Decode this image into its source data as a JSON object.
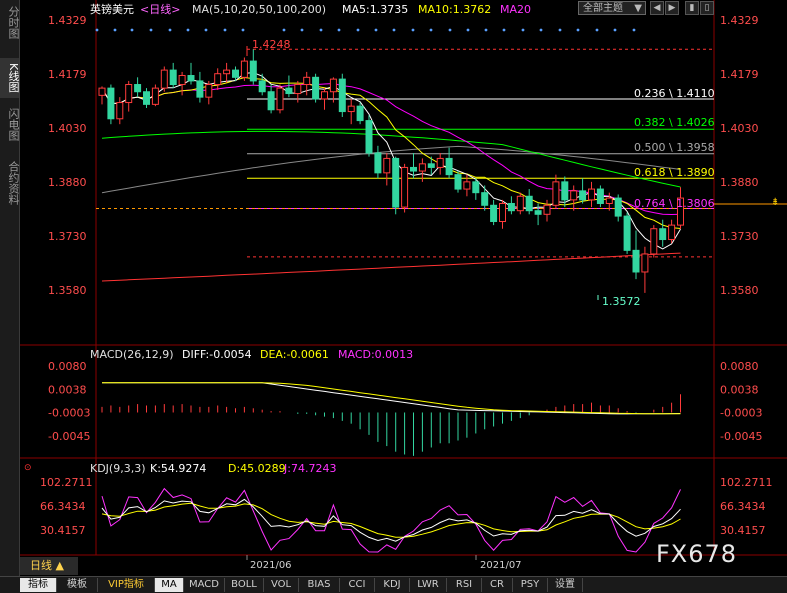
{
  "left_tabs": [
    {
      "label": "分时图",
      "active": false
    },
    {
      "label": "K线图",
      "active": true
    },
    {
      "label": "闪电图",
      "active": false
    },
    {
      "label": "合约资料",
      "active": false
    }
  ],
  "header": {
    "symbol": "英镑美元",
    "period_tag": "<日线>",
    "ma_label": "MA(5,10,20,50,100,200)",
    "ma5": "MA5:1.3735",
    "ma10": "MA10:1.3762",
    "ma20": "MA20",
    "topic_select": "全部主题",
    "colors": {
      "ma5": "#ffffff",
      "ma10": "#ffff00",
      "ma20": "#ff00ff",
      "ma50": "#00ff00",
      "ma100": "#888888",
      "ma200": "#ff3333"
    }
  },
  "price_axis": {
    "labels": [
      "1.4329",
      "1.4179",
      "1.4030",
      "1.3880",
      "1.3730",
      "1.3580"
    ]
  },
  "annotations": {
    "high_label": "1.4248",
    "low_label": "1.3572",
    "fib": [
      {
        "label": "0.236 \\ 1.4110",
        "color": "#ffffff"
      },
      {
        "label": "0.382 \\ 1.4026",
        "color": "#00ff00"
      },
      {
        "label": "0.500 \\ 1.3958",
        "color": "#aaaaaa"
      },
      {
        "label": "0.618 \\ 1.3890",
        "color": "#ffff00"
      },
      {
        "label": "0.764 \\ 1.3806",
        "color": "#ff33ff"
      }
    ]
  },
  "macd": {
    "label": "MACD(26,12,9)",
    "diff": "DIFF:-0.0054",
    "dea": "DEA:-0.0061",
    "macd": "MACD:0.0013",
    "axis": [
      "0.0080",
      "0.0038",
      "-0.0003",
      "-0.0045"
    ]
  },
  "kdj": {
    "label": "KDJ(9,3,3)",
    "k": "K:54.9274",
    "d": "D:45.0289",
    "j": "J:74.7243",
    "axis": [
      "102.2711",
      "66.3434",
      "30.4157"
    ]
  },
  "time_axis": [
    "2021/06",
    "2021/07"
  ],
  "period_button": "日线 ▲",
  "watermark": "FX678",
  "bottom_tabs": [
    "指标",
    "模板",
    "VIP指标",
    "MA",
    "MACD",
    "BOLL",
    "VOL",
    "BIAS",
    "CCI",
    "KDJ",
    "LWR",
    "RSI",
    "CR",
    "PSY",
    "设置"
  ],
  "chart_data": {
    "type": "candlestick",
    "candles": [
      [
        1.412,
        1.4145,
        1.4095,
        1.414
      ],
      [
        1.414,
        1.415,
        1.404,
        1.4055
      ],
      [
        1.4055,
        1.4115,
        1.404,
        1.41
      ],
      [
        1.41,
        1.416,
        1.4075,
        1.415
      ],
      [
        1.415,
        1.417,
        1.4115,
        1.413
      ],
      [
        1.413,
        1.414,
        1.4085,
        1.4095
      ],
      [
        1.4095,
        1.415,
        1.409,
        1.414
      ],
      [
        1.414,
        1.42,
        1.413,
        1.419
      ],
      [
        1.419,
        1.421,
        1.414,
        1.415
      ],
      [
        1.415,
        1.4185,
        1.412,
        1.4175
      ],
      [
        1.4175,
        1.421,
        1.415,
        1.416
      ],
      [
        1.416,
        1.4185,
        1.41,
        1.4115
      ],
      [
        1.4115,
        1.416,
        1.4095,
        1.415
      ],
      [
        1.415,
        1.4195,
        1.4135,
        1.418
      ],
      [
        1.418,
        1.421,
        1.4155,
        1.419
      ],
      [
        1.419,
        1.42,
        1.416,
        1.417
      ],
      [
        1.417,
        1.4225,
        1.416,
        1.4215
      ],
      [
        1.4215,
        1.4248,
        1.415,
        1.416
      ],
      [
        1.416,
        1.418,
        1.412,
        1.413
      ],
      [
        1.413,
        1.415,
        1.407,
        1.408
      ],
      [
        1.408,
        1.415,
        1.407,
        1.414
      ],
      [
        1.414,
        1.4175,
        1.4115,
        1.4125
      ],
      [
        1.4125,
        1.416,
        1.41,
        1.415
      ],
      [
        1.415,
        1.4185,
        1.412,
        1.417
      ],
      [
        1.417,
        1.418,
        1.41,
        1.411
      ],
      [
        1.411,
        1.414,
        1.408,
        1.413
      ],
      [
        1.413,
        1.417,
        1.41,
        1.4165
      ],
      [
        1.4165,
        1.418,
        1.406,
        1.4075
      ],
      [
        1.4075,
        1.411,
        1.404,
        1.409
      ],
      [
        1.409,
        1.41,
        1.404,
        1.405
      ],
      [
        1.405,
        1.4065,
        1.395,
        1.396
      ],
      [
        1.396,
        1.398,
        1.389,
        1.3905
      ],
      [
        1.3905,
        1.396,
        1.387,
        1.3945
      ],
      [
        1.3945,
        1.395,
        1.379,
        1.381
      ],
      [
        1.381,
        1.393,
        1.3795,
        1.392
      ],
      [
        1.392,
        1.396,
        1.389,
        1.391
      ],
      [
        1.391,
        1.3945,
        1.388,
        1.393
      ],
      [
        1.393,
        1.395,
        1.39,
        1.392
      ],
      [
        1.392,
        1.396,
        1.39,
        1.3945
      ],
      [
        1.3945,
        1.3975,
        1.389,
        1.39
      ],
      [
        1.39,
        1.391,
        1.385,
        1.386
      ],
      [
        1.386,
        1.39,
        1.384,
        1.388
      ],
      [
        1.388,
        1.389,
        1.383,
        1.385
      ],
      [
        1.385,
        1.387,
        1.38,
        1.3815
      ],
      [
        1.3815,
        1.383,
        1.376,
        1.377
      ],
      [
        1.377,
        1.383,
        1.375,
        1.382
      ],
      [
        1.382,
        1.384,
        1.379,
        1.38
      ],
      [
        1.38,
        1.385,
        1.379,
        1.384
      ],
      [
        1.384,
        1.386,
        1.379,
        1.38
      ],
      [
        1.38,
        1.382,
        1.376,
        1.379
      ],
      [
        1.379,
        1.383,
        1.377,
        1.3815
      ],
      [
        1.3815,
        1.39,
        1.3805,
        1.388
      ],
      [
        1.388,
        1.3895,
        1.381,
        1.383
      ],
      [
        1.383,
        1.387,
        1.38,
        1.3855
      ],
      [
        1.3855,
        1.389,
        1.382,
        1.383
      ],
      [
        1.383,
        1.388,
        1.381,
        1.386
      ],
      [
        1.386,
        1.387,
        1.381,
        1.382
      ],
      [
        1.382,
        1.385,
        1.38,
        1.3835
      ],
      [
        1.3835,
        1.3845,
        1.377,
        1.3785
      ],
      [
        1.3785,
        1.3795,
        1.368,
        1.369
      ],
      [
        1.369,
        1.3745,
        1.361,
        1.363
      ],
      [
        1.363,
        1.37,
        1.3572,
        1.368
      ],
      [
        1.368,
        1.376,
        1.367,
        1.375
      ],
      [
        1.375,
        1.3775,
        1.37,
        1.372
      ],
      [
        1.372,
        1.3775,
        1.371,
        1.376
      ],
      [
        1.376,
        1.3865,
        1.375,
        1.3835
      ]
    ],
    "macd_hist": [
      0.0004,
      0.0005,
      0.0004,
      0.0005,
      0.0006,
      0.0005,
      0.0005,
      0.0006,
      0.0005,
      0.0006,
      0.0005,
      0.0004,
      0.0004,
      0.0005,
      0.0004,
      0.0003,
      0.0004,
      0.0003,
      0.0002,
      0.0001,
      0.0001,
      0.0,
      -0.0001,
      -0.0001,
      -0.0002,
      -0.0003,
      -0.0004,
      -0.0006,
      -0.0008,
      -0.0012,
      -0.0016,
      -0.0021,
      -0.0024,
      -0.0028,
      -0.003,
      -0.0031,
      -0.0028,
      -0.0025,
      -0.0022,
      -0.0022,
      -0.002,
      -0.0018,
      -0.0015,
      -0.0012,
      -0.001,
      -0.0008,
      -0.0006,
      -0.0004,
      -0.0002,
      0.0,
      0.0002,
      0.0004,
      0.0005,
      0.0006,
      0.0006,
      0.0007,
      0.0005,
      0.0005,
      0.0003,
      0.0001,
      -0.0001,
      0.0,
      0.0002,
      0.0004,
      0.0007,
      0.0013
    ]
  }
}
